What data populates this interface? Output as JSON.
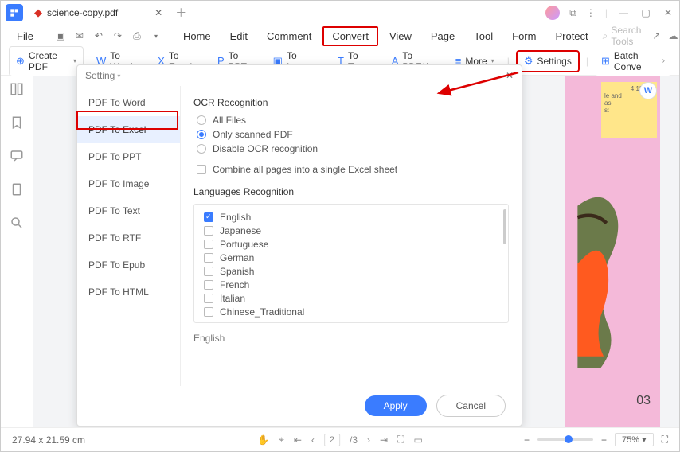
{
  "tab": {
    "title": "science-copy.pdf"
  },
  "menu": {
    "file": "File",
    "home": "Home",
    "edit": "Edit",
    "comment": "Comment",
    "convert": "Convert",
    "view": "View",
    "page": "Page",
    "tool": "Tool",
    "form": "Form",
    "protect": "Protect"
  },
  "search": {
    "placeholder": "Search Tools"
  },
  "toolbar": {
    "create": "Create PDF",
    "word": "To Word",
    "excel": "To Excel",
    "ppt": "To PPT",
    "image": "To Image",
    "text": "To Text",
    "pdfa": "To PDF/A",
    "more": "More",
    "settings": "Settings",
    "batch": "Batch Conve"
  },
  "panel": {
    "title": "Setting",
    "side": [
      "PDF To Word",
      "PDF To Excel",
      "PDF To PPT",
      "PDF To Image",
      "PDF To Text",
      "PDF To RTF",
      "PDF To Epub",
      "PDF To HTML"
    ],
    "ocr_title": "OCR Recognition",
    "ocr_all": "All Files",
    "ocr_scanned": "Only scanned PDF",
    "ocr_disable": "Disable OCR recognition",
    "combine": "Combine all pages into a single Excel sheet",
    "lang_title": "Languages Recognition",
    "langs": [
      "English",
      "Japanese",
      "Portuguese",
      "German",
      "Spanish",
      "French",
      "Italian",
      "Chinese_Traditional"
    ],
    "selected_lang": "English",
    "apply": "Apply",
    "cancel": "Cancel"
  },
  "sticky": {
    "time": "4:11 PM",
    "l1": "le and",
    "l2": "as.",
    "l3": "s:"
  },
  "page_ix": "03",
  "status": {
    "dim": "27.94 x 21.59 cm",
    "page": "2",
    "pages": "/3",
    "zoom": "75%"
  }
}
